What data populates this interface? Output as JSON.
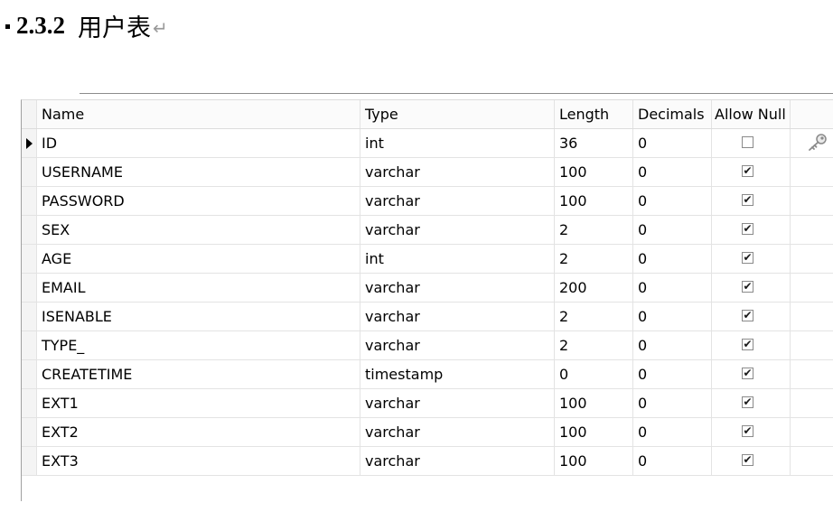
{
  "heading": {
    "number": "2.3.2",
    "title": "用户表",
    "para_mark": "↵"
  },
  "table": {
    "columns": [
      "Name",
      "Type",
      "Length",
      "Decimals",
      "Allow Null"
    ],
    "rows": [
      {
        "name": "ID",
        "type": "int",
        "length": "36",
        "decimals": "0",
        "allow_null": false,
        "primary_key": true,
        "current": true
      },
      {
        "name": "USERNAME",
        "type": "varchar",
        "length": "100",
        "decimals": "0",
        "allow_null": true
      },
      {
        "name": "PASSWORD",
        "type": "varchar",
        "length": "100",
        "decimals": "0",
        "allow_null": true
      },
      {
        "name": "SEX",
        "type": "varchar",
        "length": "2",
        "decimals": "0",
        "allow_null": true
      },
      {
        "name": "AGE",
        "type": "int",
        "length": "2",
        "decimals": "0",
        "allow_null": true
      },
      {
        "name": "EMAIL",
        "type": "varchar",
        "length": "200",
        "decimals": "0",
        "allow_null": true
      },
      {
        "name": "ISENABLE",
        "type": "varchar",
        "length": "2",
        "decimals": "0",
        "allow_null": true
      },
      {
        "name": "TYPE_",
        "type": "varchar",
        "length": "2",
        "decimals": "0",
        "allow_null": true
      },
      {
        "name": "CREATETIME",
        "type": "timestamp",
        "length": "0",
        "decimals": "0",
        "allow_null": true
      },
      {
        "name": "EXT1",
        "type": "varchar",
        "length": "100",
        "decimals": "0",
        "allow_null": true
      },
      {
        "name": "EXT2",
        "type": "varchar",
        "length": "100",
        "decimals": "0",
        "allow_null": true
      },
      {
        "name": "EXT3",
        "type": "varchar",
        "length": "100",
        "decimals": "0",
        "allow_null": true
      }
    ],
    "checkbox_checked_glyph": "✔",
    "key_icon": "key-icon"
  }
}
